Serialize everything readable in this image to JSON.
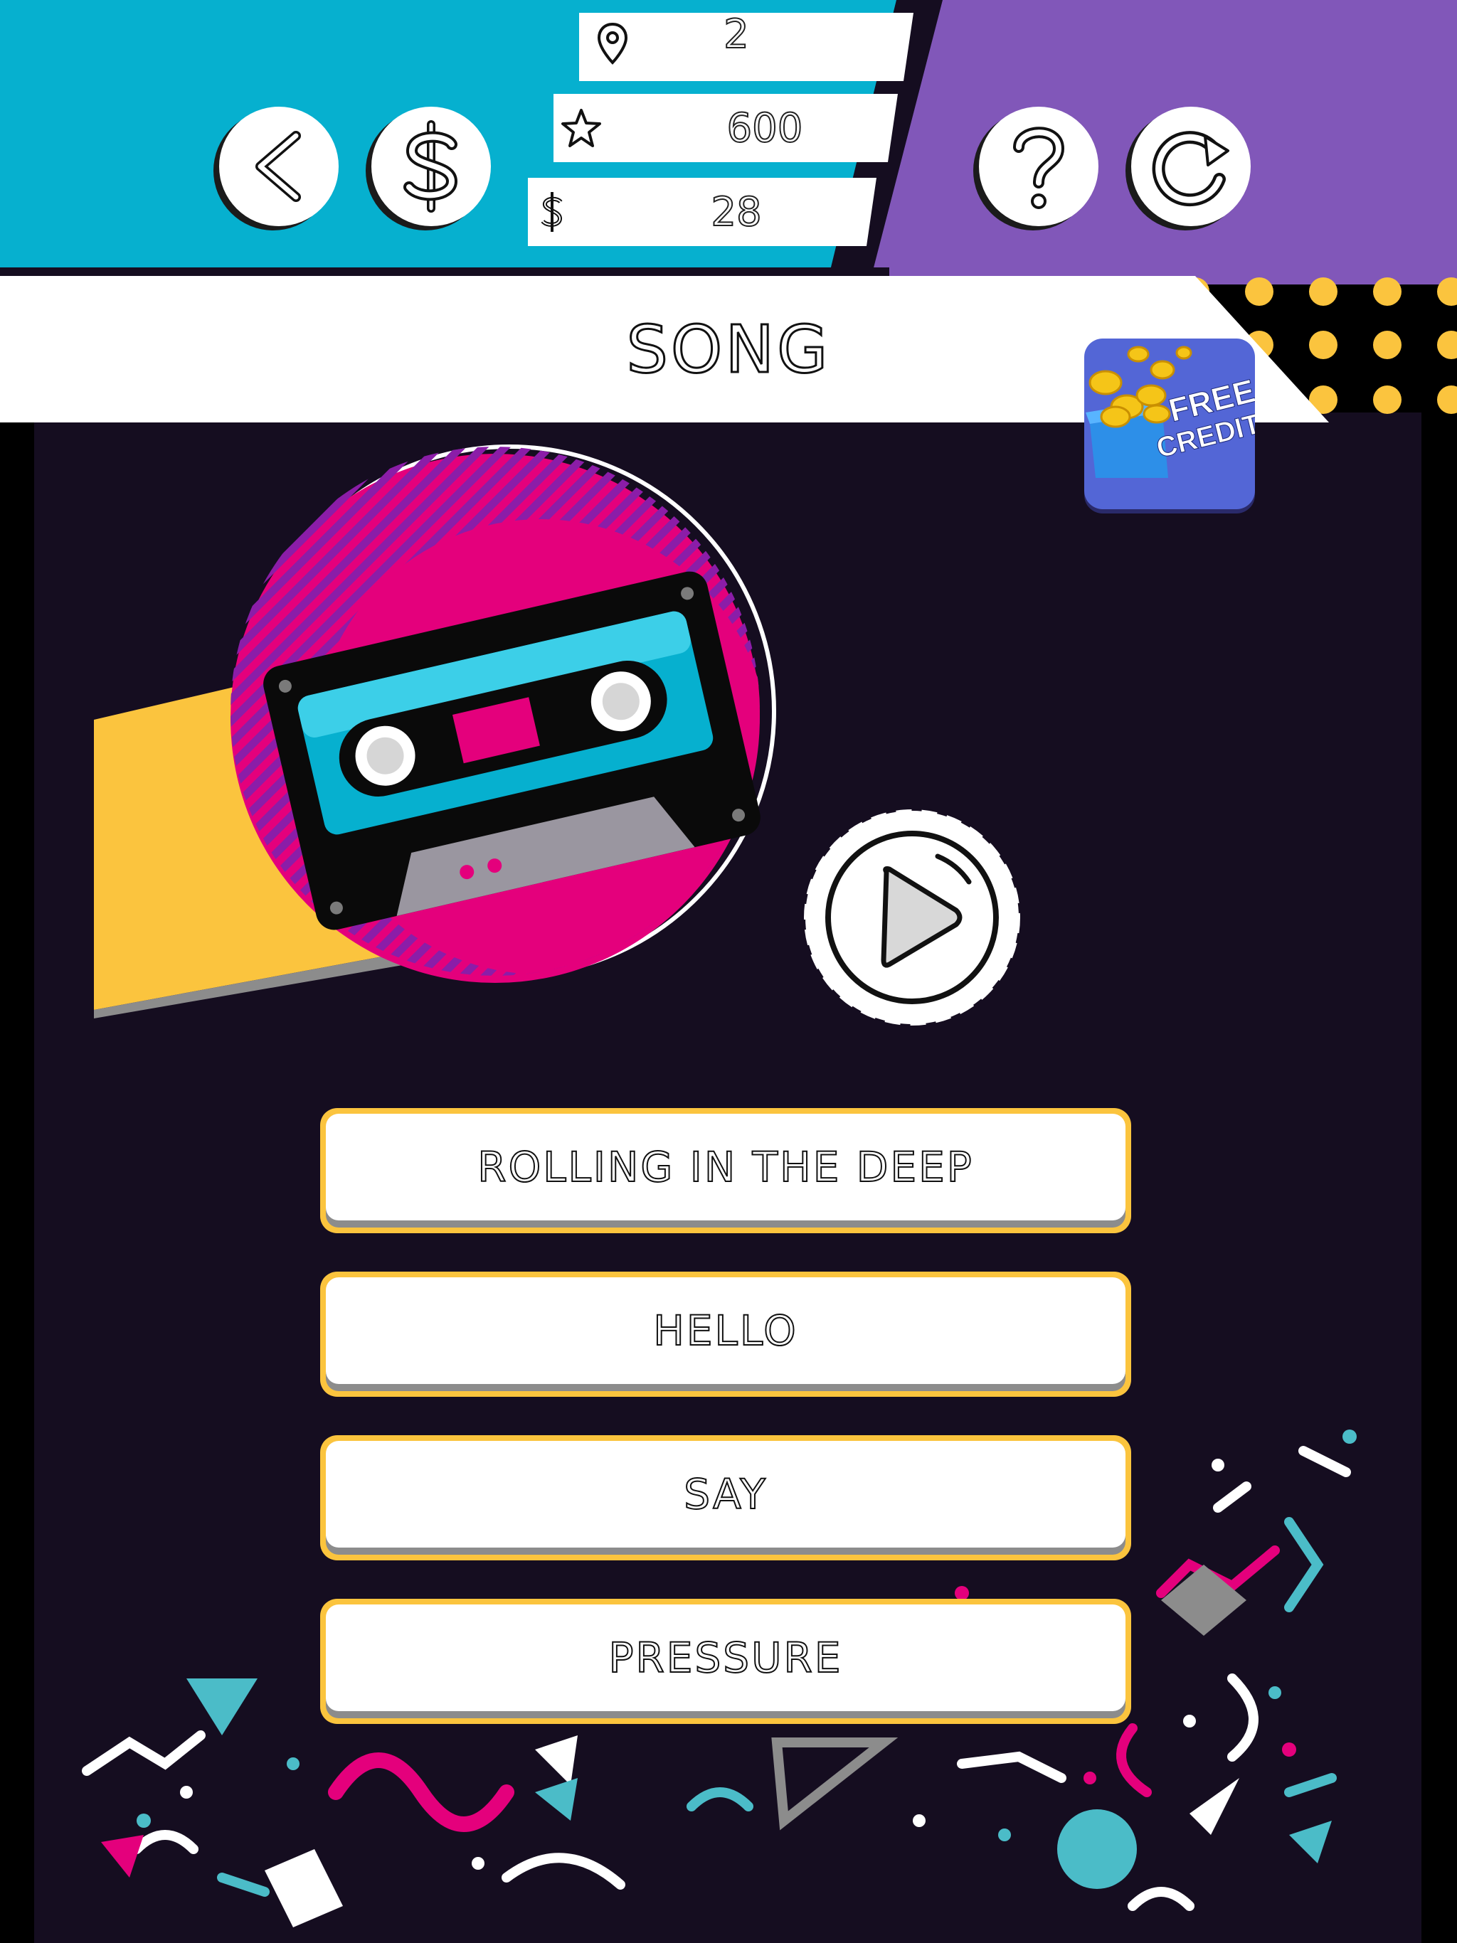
{
  "header": {
    "stats": {
      "level": "2",
      "stars": "600",
      "coins": "28"
    },
    "icons": {
      "back": "back-chevron-icon",
      "shop": "dollar-icon",
      "help": "question-icon",
      "restart": "restart-icon",
      "level": "map-pin-icon",
      "stars": "star-icon",
      "coins": "dollar-icon"
    }
  },
  "question": {
    "category": "SONG"
  },
  "promo": {
    "line1": "FREE",
    "line2": "CREDITS"
  },
  "answers": [
    {
      "label": "ROLLING IN THE DEEP"
    },
    {
      "label": "HELLO"
    },
    {
      "label": "SAY"
    },
    {
      "label": "PRESSURE"
    }
  ],
  "colors": {
    "cyan": "#06b0cf",
    "purple": "#8157b9",
    "yellow": "#fbc43e",
    "magenta": "#e4007c",
    "dark": "#150d20"
  }
}
